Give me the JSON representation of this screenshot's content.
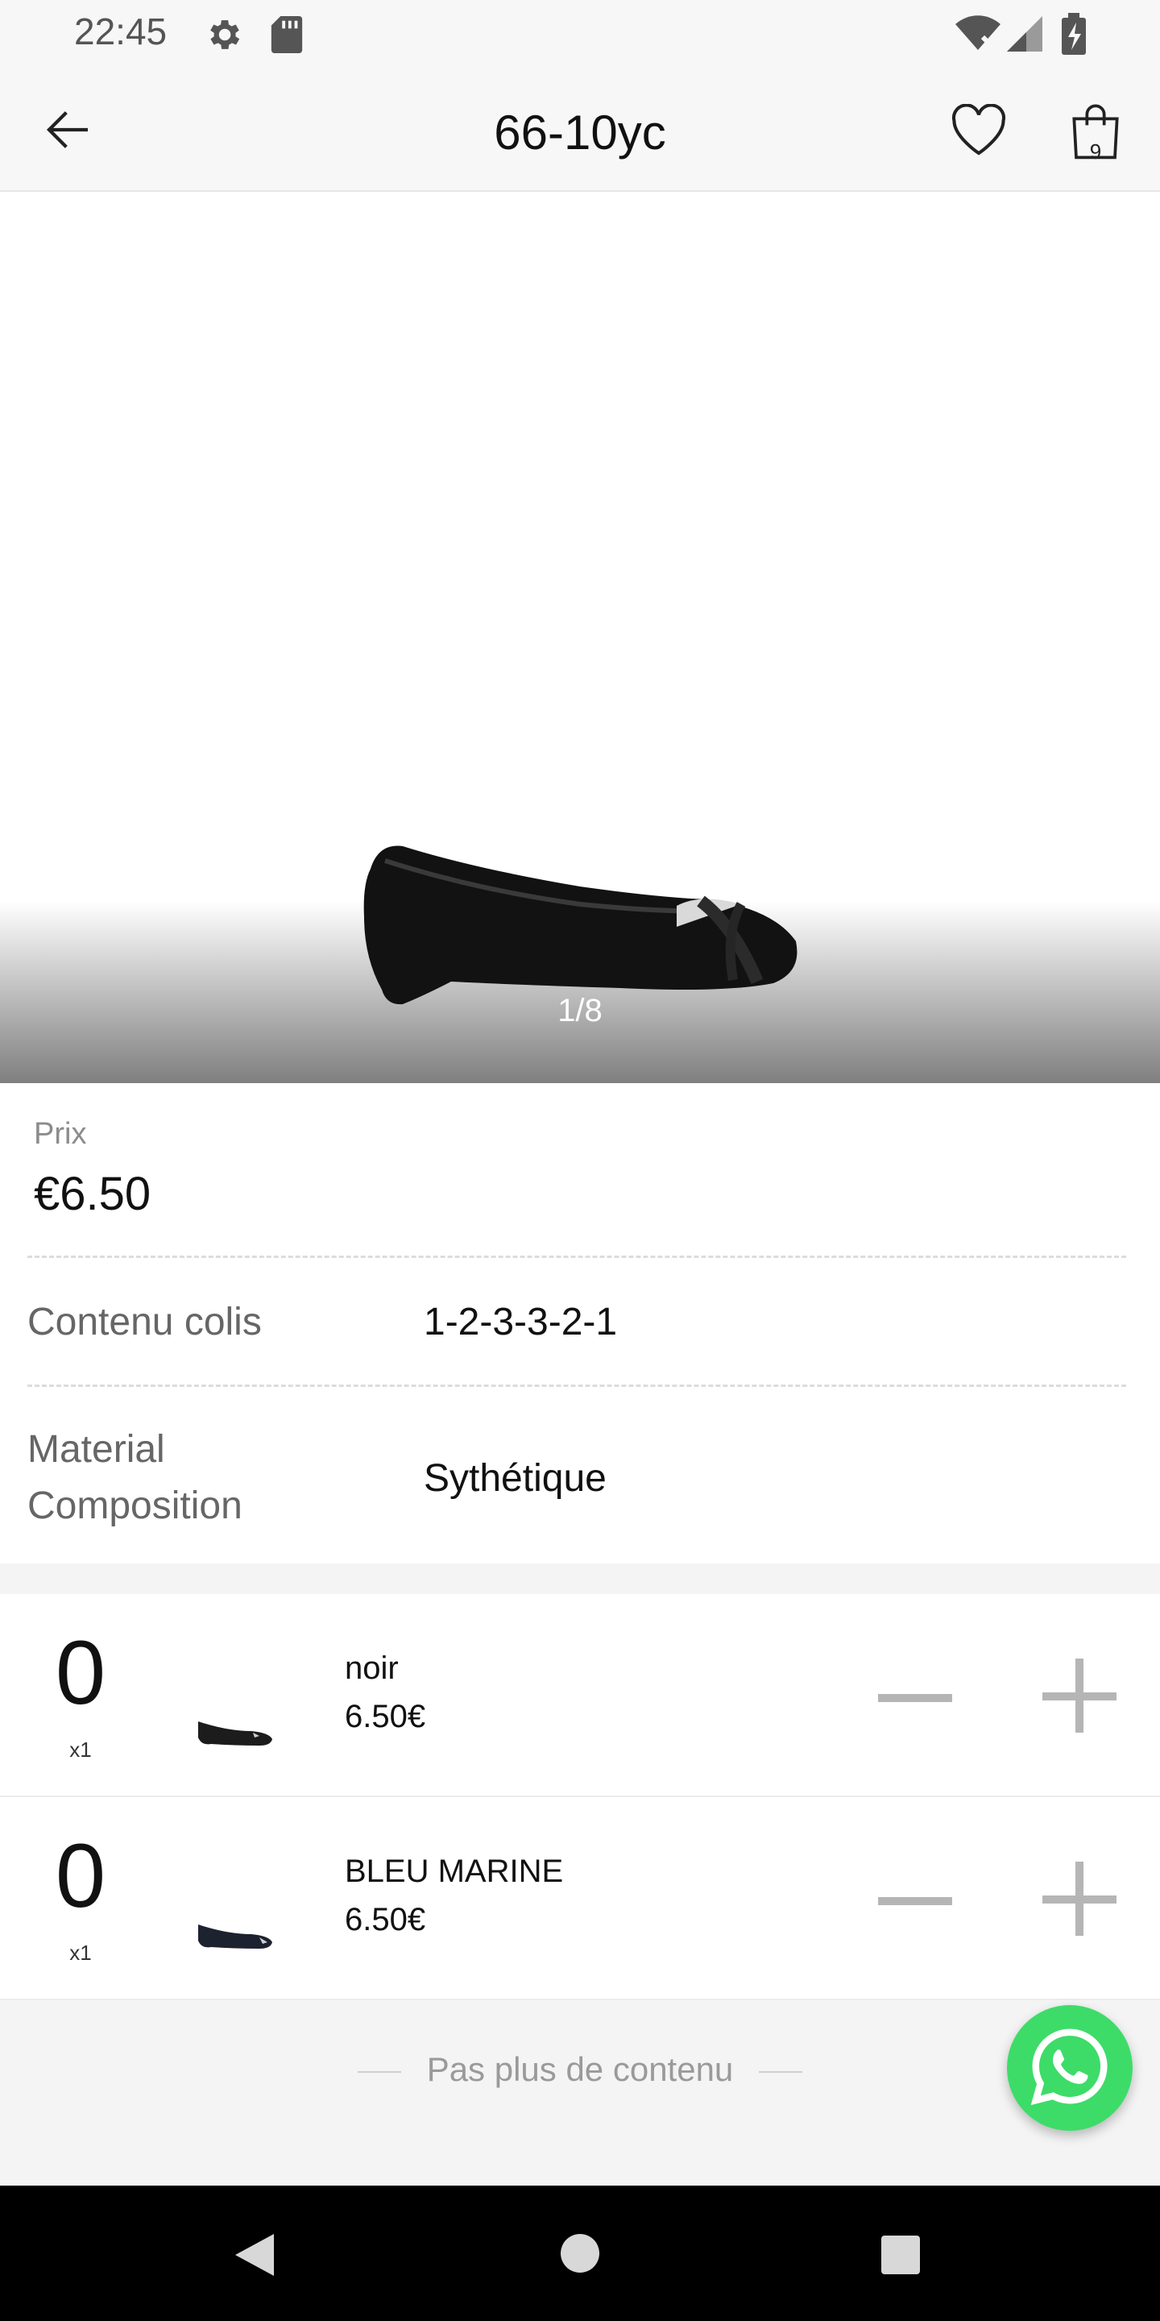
{
  "status_bar": {
    "time": "22:45"
  },
  "header": {
    "title": "66-10yc",
    "cart_count": "9"
  },
  "gallery": {
    "counter": "1/8"
  },
  "product": {
    "price_label": "Prix",
    "price": "€6.50",
    "specs": [
      {
        "label": "Contenu colis",
        "value": "1-2-3-3-2-1"
      },
      {
        "label": "Material Composition",
        "value": "Sythétique"
      }
    ]
  },
  "variants": [
    {
      "quantity": "0",
      "multiplier": "x1",
      "name": "noir",
      "price": "6.50€",
      "color": "#1c1c1c"
    },
    {
      "quantity": "0",
      "multiplier": "x1",
      "name": "BLEU MARINE",
      "price": "6.50€",
      "color": "#1d2230"
    }
  ],
  "footer": {
    "end_text": "Pas plus de contenu"
  },
  "colors": {
    "whatsapp": "#3ddc68",
    "nav_bar": "#000000"
  },
  "icons": [
    "gear-icon",
    "sd-card-icon",
    "wifi-icon",
    "signal-icon",
    "battery-charging-icon",
    "back-arrow-icon",
    "heart-icon",
    "shopping-bag-icon",
    "whatsapp-icon",
    "nav-back-icon",
    "nav-home-icon",
    "nav-recents-icon"
  ]
}
